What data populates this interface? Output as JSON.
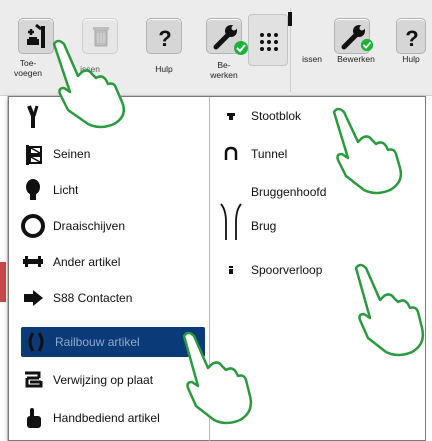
{
  "toolbar": {
    "left": [
      {
        "name": "add",
        "label_line1": "Toe-",
        "label_line2": "voegen"
      },
      {
        "name": "delete",
        "label_line1": "issen",
        "label_line2": ""
      },
      {
        "name": "help",
        "label_line1": "Hulp",
        "label_line2": ""
      },
      {
        "name": "edit",
        "label_line1": "Be-",
        "label_line2": "werken"
      }
    ],
    "right": [
      {
        "name": "delete",
        "label": "issen"
      },
      {
        "name": "edit",
        "label": "Bewerken"
      },
      {
        "name": "help",
        "label": "Hulp"
      }
    ]
  },
  "menu": {
    "left_items": [
      {
        "id": "wissels",
        "label": ""
      },
      {
        "id": "seinen",
        "label": "Seinen"
      },
      {
        "id": "licht",
        "label": "Licht"
      },
      {
        "id": "draaischijven",
        "label": "Draaischijven"
      },
      {
        "id": "ander",
        "label": "Ander artikel"
      },
      {
        "id": "s88",
        "label": "S88 Contacten"
      },
      {
        "id": "railbouw",
        "label": "Railbouw artikel",
        "selected": true
      },
      {
        "id": "verwijzing",
        "label": "Verwijzing op plaat"
      },
      {
        "id": "handbediend",
        "label": "Handbediend artikel"
      }
    ],
    "right_items": [
      {
        "id": "stootblok",
        "label": "Stootblok"
      },
      {
        "id": "tunnel",
        "label": "Tunnel"
      },
      {
        "id": "bruggenhoofd",
        "label": "Bruggenhoofd"
      },
      {
        "id": "brug",
        "label": "Brug"
      },
      {
        "id": "spoorverloop",
        "label": "Spoorverloop"
      }
    ]
  },
  "colors": {
    "selection": "#0b3a78",
    "check": "#1db33a",
    "hand_outline": "#2b9a3f",
    "toolbar_bg": "#ececec"
  },
  "icons": [
    "wissel-icon",
    "signal-icon",
    "bulb-icon",
    "turntable-icon",
    "crane-icon",
    "arrow-icon",
    "bracket-icon",
    "link-icon",
    "hand-pointer-icon",
    "buffer-stop-icon",
    "tunnel-icon",
    "bridge-icon",
    "track-end-icon",
    "wrench-icon",
    "trash-icon",
    "question-icon",
    "grid-icon"
  ]
}
